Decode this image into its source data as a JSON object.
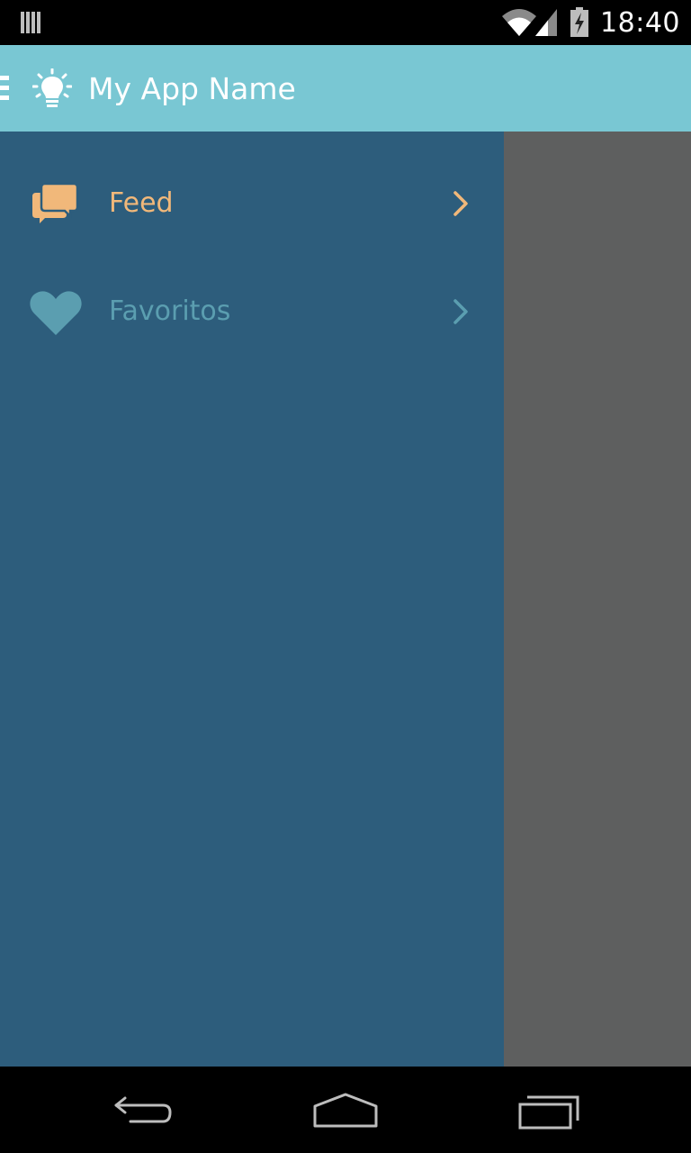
{
  "status_bar": {
    "time": "18:40",
    "icons": [
      "signal-bars-icon",
      "wifi-icon",
      "cell-signal-icon",
      "battery-charging-icon"
    ]
  },
  "action_bar": {
    "title": "My App Name",
    "menu_icon": "hamburger-menu-icon",
    "app_icon": "lightbulb-icon",
    "background": "#79c7d3"
  },
  "drawer": {
    "background": "#2d5d7c",
    "items": [
      {
        "label": "Feed",
        "icon": "chat-bubbles-icon",
        "color": "#f1b87a",
        "selected": true
      },
      {
        "label": "Favoritos",
        "icon": "heart-icon",
        "color": "#5b9eb0",
        "selected": false
      }
    ]
  },
  "content_overlay": {
    "color": "#5e5f5f"
  },
  "nav_bar": {
    "buttons": [
      "back-icon",
      "home-icon",
      "recent-apps-icon"
    ]
  }
}
